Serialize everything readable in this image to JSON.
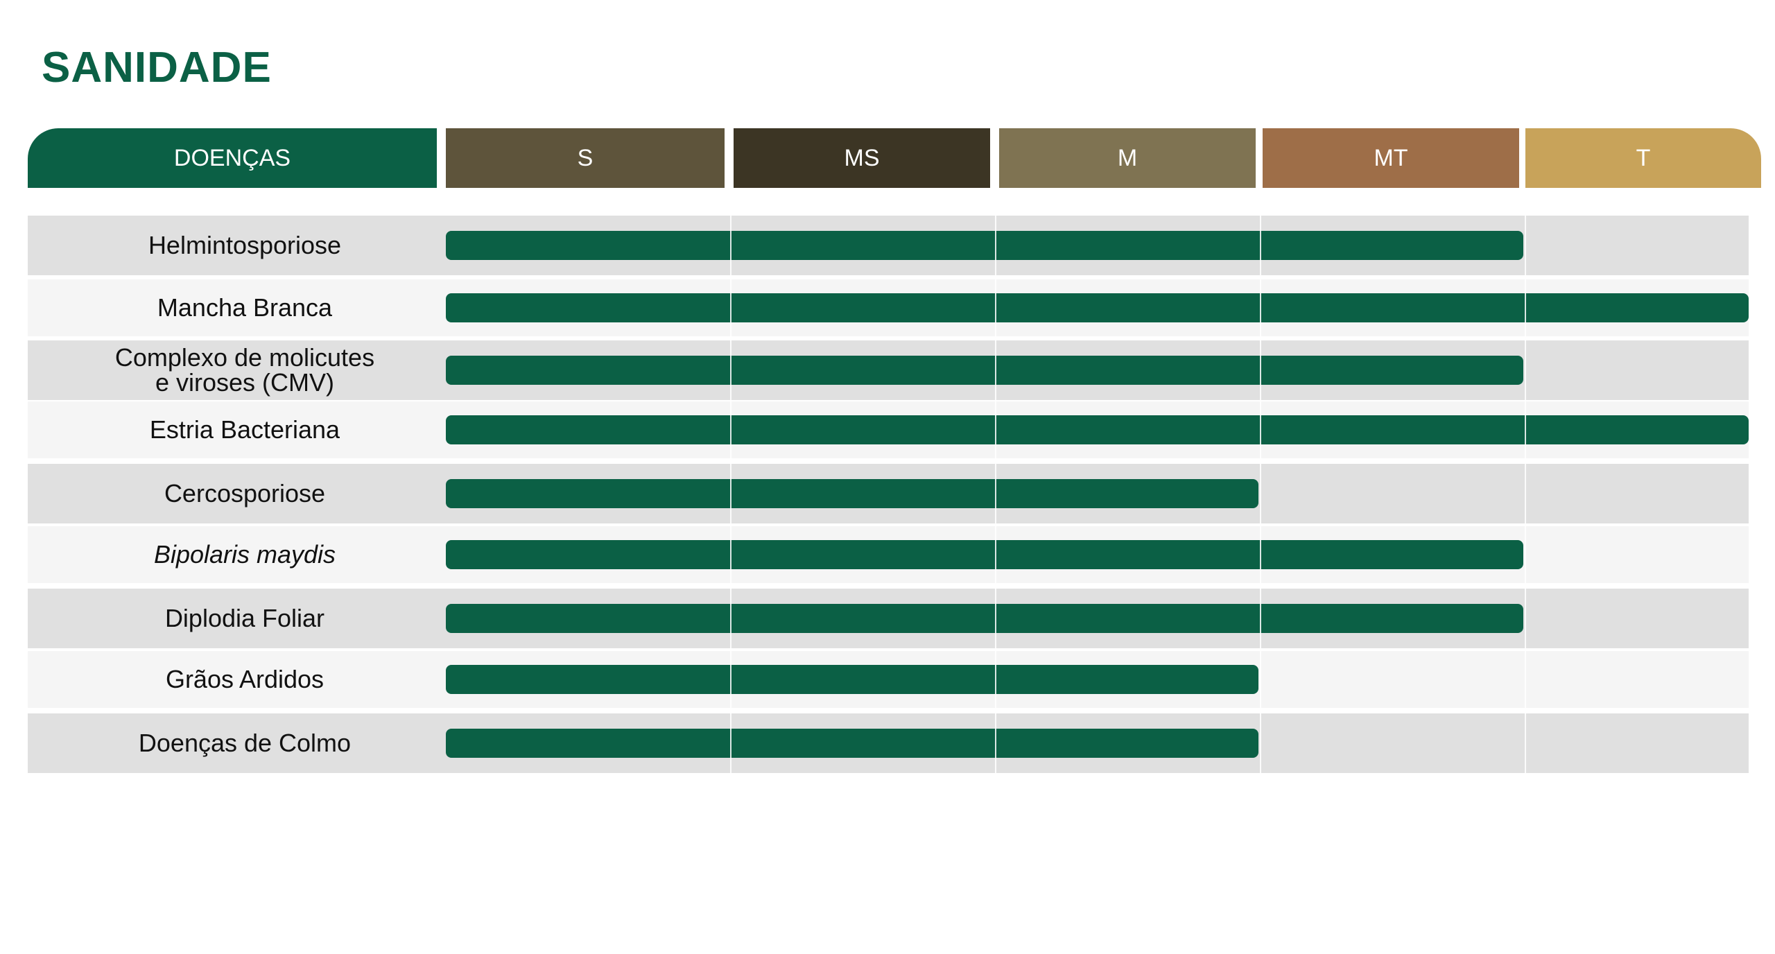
{
  "title": "SANIDADE",
  "colors": {
    "brand": "#0b6045",
    "row_dark": "#e0e0e0",
    "row_light": "#f5f5f5"
  },
  "chart_data": {
    "type": "bar",
    "orientation": "horizontal",
    "scale_header_label": "DOENÇAS",
    "scale": [
      {
        "label": "S",
        "color": "#5e543b"
      },
      {
        "label": "MS",
        "color": "#3c3524"
      },
      {
        "label": "M",
        "color": "#7f7352"
      },
      {
        "label": "MT",
        "color": "#9e6e48"
      },
      {
        "label": "T",
        "color": "#c8a35a"
      }
    ],
    "categories": [
      "Helmintosporiose",
      "Mancha Branca",
      "Complexo de molicutes e viroses (CMV)",
      "Estria Bacteriana",
      "Cercosporiose",
      "Bipolaris maydis",
      "Diplodia Foliar",
      "Grãos Ardidos",
      "Doenças de Colmo"
    ],
    "category_labels_multiline": {
      "2": [
        "Complexo de molicutes",
        "e viroses (CMV)"
      ]
    },
    "italic_categories": [
      "Bipolaris maydis"
    ],
    "values": [
      "MT",
      "T",
      "MT",
      "T",
      "M",
      "MT",
      "MT",
      "M",
      "M"
    ],
    "levels": [
      4,
      5,
      4,
      5,
      3,
      4,
      4,
      3,
      3
    ]
  }
}
